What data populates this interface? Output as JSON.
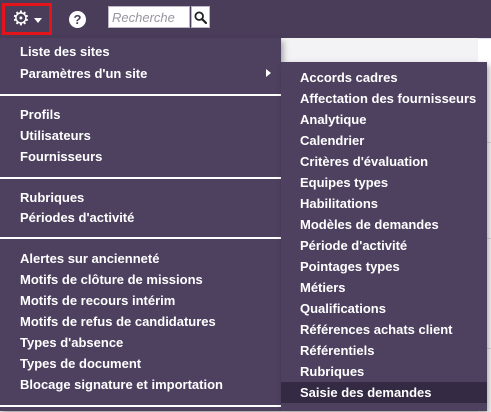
{
  "topbar": {
    "search_placeholder": "Recherche",
    "help_glyph": "?",
    "icons": {
      "settings": "gear-icon",
      "caret": "caret-down-icon",
      "help": "question-icon",
      "search": "magnifier-icon"
    }
  },
  "menu": {
    "group1": [
      "Liste des sites",
      "Paramètres d'un site"
    ],
    "group2": [
      "Profils",
      "Utilisateurs",
      "Fournisseurs"
    ],
    "group3": [
      "Rubriques",
      "Périodes d'activité"
    ],
    "group4": [
      "Alertes sur ancienneté",
      "Motifs de clôture de missions",
      "Motifs de recours intérim",
      "Motifs de refus de candidatures",
      "Types d'absence",
      "Types de document",
      "Blocage signature et importation"
    ]
  },
  "submenu": {
    "items": [
      "Accords cadres",
      "Affectation des fournisseurs",
      "Analytique",
      "Calendrier",
      "Critères d'évaluation",
      "Equipes types",
      "Habilitations",
      "Modèles de demandes",
      "Période d'activité",
      "Pointages types",
      "Métiers",
      "Qualifications",
      "Références achats client",
      "Référentiels",
      "Rubriques",
      "Saisie des demandes"
    ],
    "highlighted": "Saisie des demandes"
  },
  "colors": {
    "menu_bg": "#4e4160",
    "topbar_bg": "#4a3d5a",
    "highlight_bg": "#342a43",
    "focus_border": "#e3141a"
  }
}
